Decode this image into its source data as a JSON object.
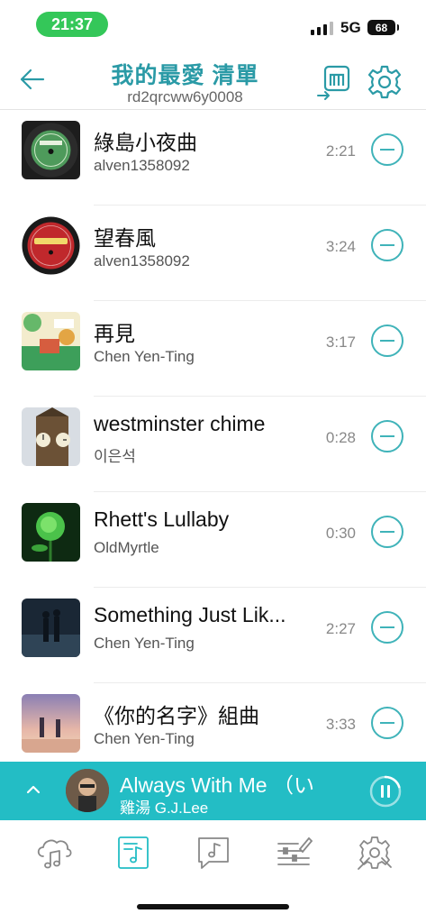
{
  "status_bar": {
    "time": "21:37",
    "network": "5G",
    "battery": "68"
  },
  "header": {
    "title": "我的最愛 清單",
    "subtitle": "rd2qrcww6y0008",
    "back_icon": "arrow-left-icon",
    "import_icon": "import-playlist-icon",
    "settings_icon": "gear-icon"
  },
  "songs": [
    {
      "title": "綠島小夜曲",
      "artist": "alven1358092",
      "duration": "2:21"
    },
    {
      "title": "望春風",
      "artist": "alven1358092",
      "duration": "3:24"
    },
    {
      "title": "再見",
      "artist": "Chen Yen-Ting",
      "duration": "3:17"
    },
    {
      "title": "westminster chime",
      "artist": "이은석",
      "duration": "0:28"
    },
    {
      "title": "Rhett's Lullaby",
      "artist": "OldMyrtle",
      "duration": "0:30"
    },
    {
      "title": "Something Just Lik...",
      "artist": "Chen Yen-Ting",
      "duration": "2:27"
    },
    {
      "title": "《你的名字》組曲",
      "artist": "Chen Yen-Ting",
      "duration": "3:33"
    }
  ],
  "now_playing": {
    "title": "Always With Me （い",
    "artist": "雞湯 G.J.Lee",
    "progress": 0.2
  },
  "bottom_nav": [
    {
      "icon": "cloud-music-icon"
    },
    {
      "icon": "playlist-icon",
      "active": true
    },
    {
      "icon": "music-chat-icon"
    },
    {
      "icon": "equalizer-edit-icon"
    },
    {
      "icon": "tools-gear-icon"
    }
  ],
  "colors": {
    "accent": "#23bdc5",
    "accent_dark": "#2a9aa6",
    "time_pill": "#34c759"
  }
}
